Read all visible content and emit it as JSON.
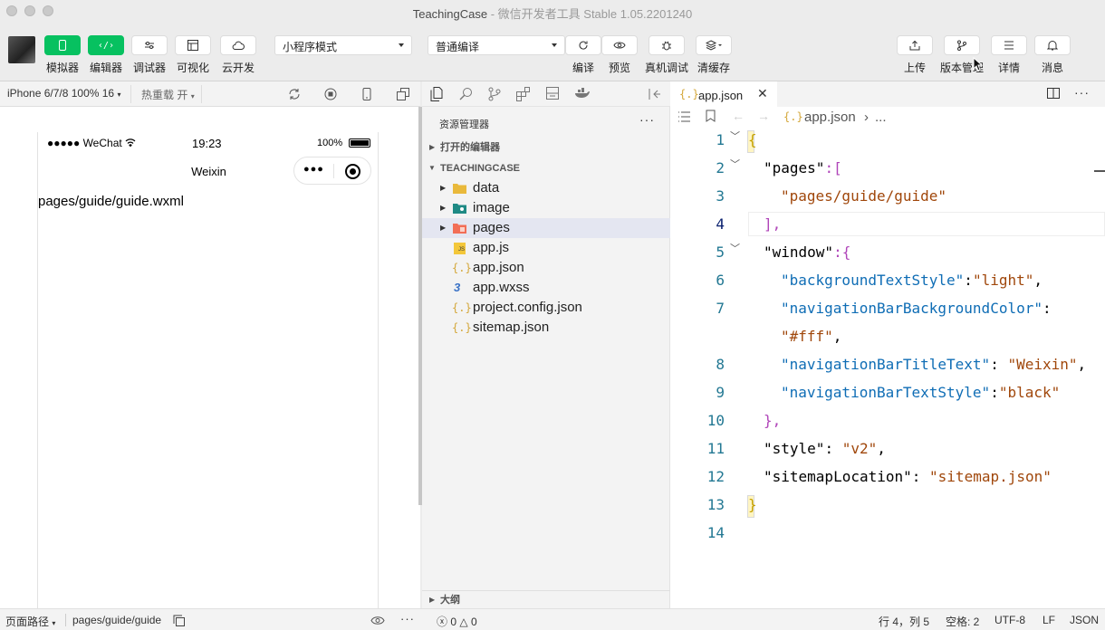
{
  "window": {
    "title": "TeachingCase",
    "subtitle": " - 微信开发者工具 Stable 1.05.2201240"
  },
  "toolbar": {
    "left_buttons": [
      {
        "label": "模拟器",
        "icon": "phone-icon"
      },
      {
        "label": "编辑器",
        "icon": "code-icon"
      },
      {
        "label": "调试器",
        "icon": "debug-sliders-icon"
      },
      {
        "label": "可视化",
        "icon": "layout-icon"
      },
      {
        "label": "云开发",
        "icon": "cloud-icon"
      }
    ],
    "mode_select": "小程序模式",
    "compile_select": "普通编译",
    "mid_buttons": [
      {
        "label": "编译",
        "icon": "refresh-icon"
      },
      {
        "label": "预览",
        "icon": "eye-icon"
      },
      {
        "label": "真机调试",
        "icon": "bug-icon"
      },
      {
        "label": "清缓存",
        "icon": "layers-icon"
      }
    ],
    "right_buttons": [
      {
        "label": "上传",
        "icon": "upload-icon"
      },
      {
        "label": "版本管理",
        "icon": "branch-icon"
      },
      {
        "label": "详情",
        "icon": "menu-icon"
      },
      {
        "label": "消息",
        "icon": "bell-icon"
      }
    ]
  },
  "simulator": {
    "device": "iPhone 6/7/8 100% 16",
    "hot_reload": "热重载 开",
    "status_carrier": "●●●●● WeChat",
    "status_time": "19:23",
    "status_battery": "100%",
    "nav_title": "Weixin",
    "page_text": "pages/guide/guide.wxml"
  },
  "explorer": {
    "title": "资源管理器",
    "open_editors": "打开的编辑器",
    "project": "TEACHINGCASE",
    "outline": "大纲",
    "items": [
      {
        "name": "data",
        "type": "folder"
      },
      {
        "name": "image",
        "type": "folder-image"
      },
      {
        "name": "pages",
        "type": "folder-pages"
      },
      {
        "name": "app.js",
        "type": "js"
      },
      {
        "name": "app.json",
        "type": "json"
      },
      {
        "name": "app.wxss",
        "type": "css"
      },
      {
        "name": "project.config.json",
        "type": "json"
      },
      {
        "name": "sitemap.json",
        "type": "json"
      }
    ]
  },
  "editor": {
    "tab": "app.json",
    "breadcrumb_file": "app.json",
    "breadcrumb_more": "...",
    "line_numbers": [
      "1",
      "2",
      "3",
      "4",
      "5",
      "6",
      "7",
      "",
      "8",
      "9",
      "10",
      "11",
      "12",
      "13",
      "14"
    ],
    "code": {
      "l1": "{",
      "l2_key": "\"pages\"",
      "l2_rest": ":[",
      "l3": "\"pages/guide/guide\"",
      "l4": "],",
      "l5_key": "\"window\"",
      "l5_rest": ":{",
      "l6_key": "\"backgroundTextStyle\"",
      "l6_val": "\"light\"",
      "l7_key": "\"navigationBarBackgroundColor\"",
      "l7b_val": "\"#fff\"",
      "l8_key": "\"navigationBarTitleText\"",
      "l8_val": "\"Weixin\"",
      "l9_key": "\"navigationBarTextStyle\"",
      "l9_val": "\"black\"",
      "l10": "},",
      "l11_key": "\"style\"",
      "l11_val": "\"v2\"",
      "l12_key": "\"sitemapLocation\"",
      "l12_val": "\"sitemap.json\"",
      "l13": "}"
    }
  },
  "status": {
    "page_path_label": "页面路径",
    "page_path": "pages/guide/guide",
    "errors": "0",
    "warnings": "0",
    "cursor": "行 4，列 5",
    "spaces": "空格: 2",
    "encoding": "UTF-8",
    "eol": "LF",
    "language": "JSON"
  },
  "colors": {
    "accent_green": "#07c160",
    "line_number": "#237893",
    "json_key": "#0451a5",
    "json_string": "#a31515"
  }
}
